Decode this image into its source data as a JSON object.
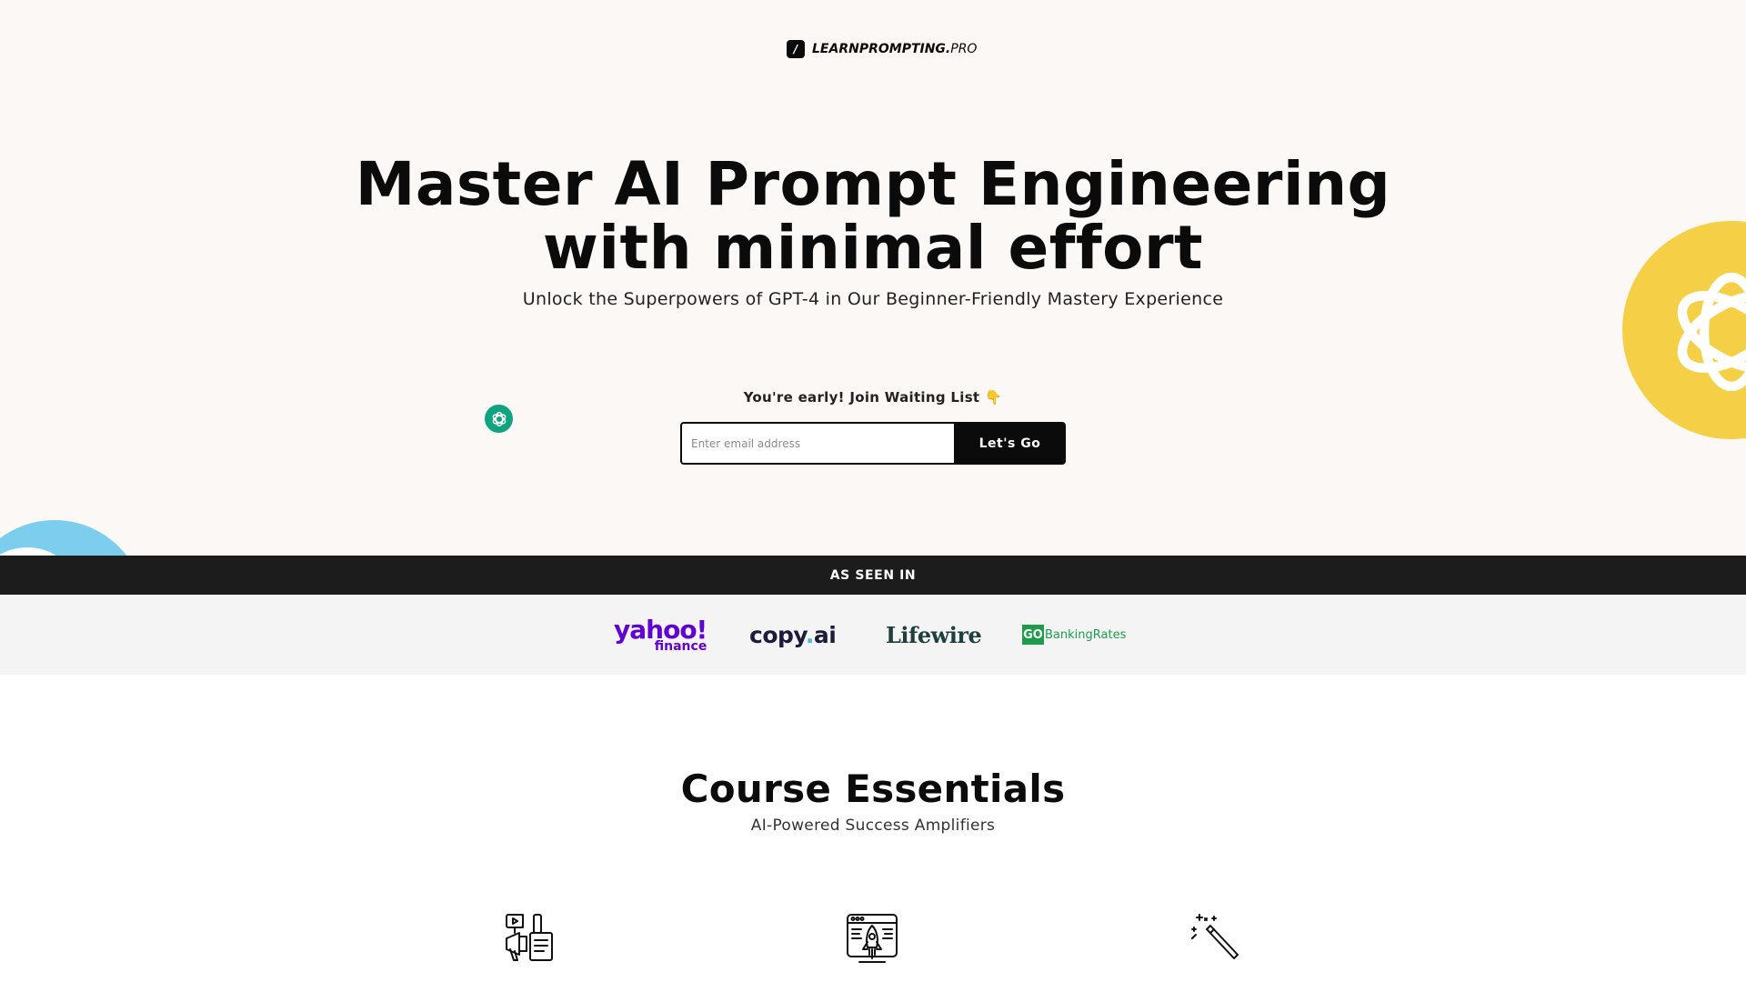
{
  "brand": {
    "mark": "/",
    "name_bold": "LEARNPROMPTING.",
    "name_light": "PRO"
  },
  "hero": {
    "headline_line1": "Master AI Prompt Engineering",
    "headline_line2": "with minimal effort",
    "subheadline": "Unlock the Superpowers of GPT-4 in Our Beginner-Friendly Mastery Experience"
  },
  "waitlist": {
    "label": "You're early! Join Waiting List",
    "emoji": "👇",
    "email_placeholder": "Enter email address",
    "email_value": "",
    "submit_label": "Let's Go"
  },
  "press": {
    "heading": "AS SEEN IN",
    "logos": {
      "yahoo_word": "yahoo!",
      "yahoo_sub": "finance",
      "copy_word": "copy",
      "copy_dot": ".",
      "copy_ai": "ai",
      "lifewire": "Lifewire",
      "go_box": "GO",
      "banking": "BankingRates"
    }
  },
  "course": {
    "title": "Course Essentials",
    "subtitle": "AI-Powered Success Amplifiers",
    "feature_icons": [
      "marketing-tools-icon",
      "web-rocket-icon",
      "magic-wand-icon"
    ]
  },
  "colors": {
    "hero_bg": "#fbf8f6",
    "accent_yellow": "#f5cf45",
    "accent_green": "#10a37f",
    "accent_blue": "#7dcdef",
    "dark_bar": "#1c1c1c",
    "yahoo_purple": "#6001d2",
    "gobanking_green": "#1e9c4c"
  }
}
